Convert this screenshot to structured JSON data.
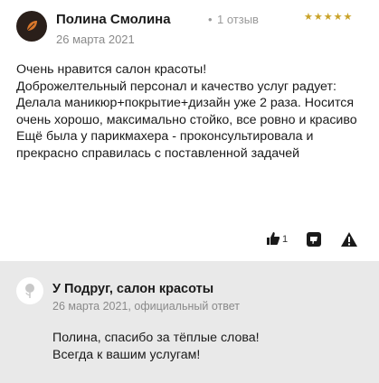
{
  "review": {
    "author": "Полина Смолина",
    "separator": "•",
    "review_count": "1 отзыв",
    "rating": 5,
    "stars": "★★★★★",
    "date": "26 марта 2021",
    "text": "Очень нравится салон красоты!\nДоброжелтельный персонал и качество услуг радует:\nДелала маникюр+покрытие+дизайн уже 2 раза. Носится очень хорошо, максимально стойко, все ровно и красиво\nЕщё была у парикмахера - проконсультировала и прекрасно справилась с поставленной задачей",
    "likes": "1",
    "icons": {
      "avatar": "leaf-icon",
      "like": "thumbs-up-icon",
      "dislike": "thumbs-down-icon",
      "report": "warning-icon"
    },
    "star_color": "#c9a227"
  },
  "reply": {
    "org_name": "У Подруг, салон красоты",
    "meta": "26 марта 2021, официальный ответ",
    "text": "Полина, спасибо за тёплые слова!\nВсегда к вашим услугам!",
    "icons": {
      "avatar": "rose-icon"
    },
    "background": "#e9e9e9"
  }
}
